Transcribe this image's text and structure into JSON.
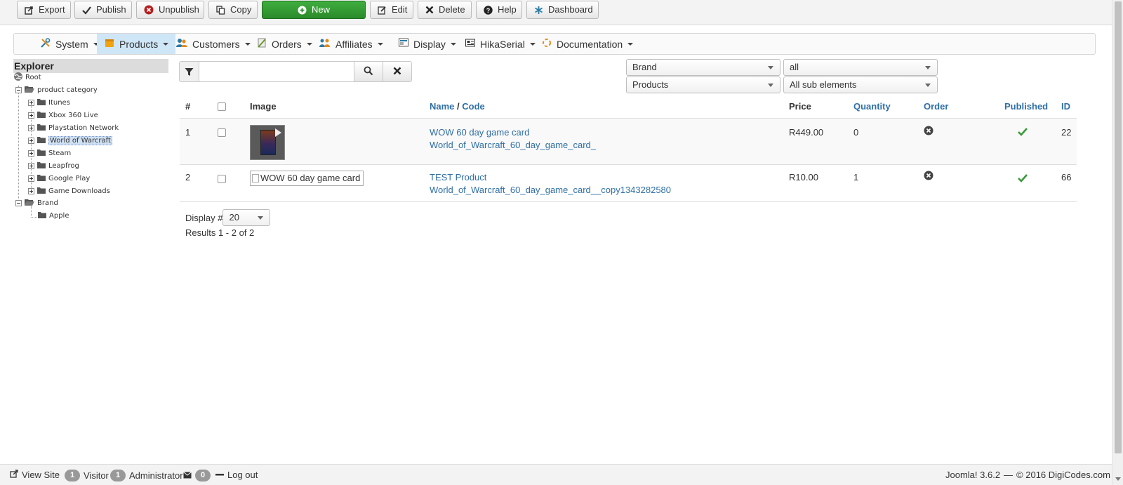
{
  "toolbar": {
    "export": "Export",
    "publish": "Publish",
    "unpublish": "Unpublish",
    "copy": "Copy",
    "new": "New",
    "edit": "Edit",
    "delete": "Delete",
    "help": "Help",
    "dashboard": "Dashboard"
  },
  "menu": {
    "system": "System",
    "products": "Products",
    "customers": "Customers",
    "orders": "Orders",
    "affiliates": "Affiliates",
    "display": "Display",
    "hikaserial": "HikaSerial",
    "documentation": "Documentation"
  },
  "explorer": {
    "title": "Explorer",
    "root": "Root",
    "product_category": "product category",
    "categories": [
      "Itunes",
      "Xbox 360 Live",
      "Playstation Network",
      "World of Warcraft",
      "Steam",
      "Leapfrog",
      "Google Play",
      "Game Downloads"
    ],
    "brand": "Brand",
    "brand_children": [
      "Apple"
    ]
  },
  "search": {
    "value": ""
  },
  "filters": {
    "brand": "Brand",
    "all": "all",
    "products": "Products",
    "sub_elements": "All sub elements"
  },
  "table": {
    "headers": {
      "num": "#",
      "image": "Image",
      "name": "Name",
      "slash": " / ",
      "code": "Code",
      "price": "Price",
      "quantity": "Quantity",
      "order": "Order",
      "published": "Published",
      "id": "ID"
    },
    "rows": [
      {
        "num": "1",
        "name": "WOW 60 day game card",
        "code": "World_of_Warcraft_60_day_game_card_",
        "price": "R449.00",
        "quantity": "0",
        "id": "22",
        "image_alt": ""
      },
      {
        "num": "2",
        "name": "TEST Product",
        "code": "World_of_Warcraft_60_day_game_card__copy1343282580",
        "price": "R10.00",
        "quantity": "1",
        "id": "66",
        "image_alt": "WOW 60 day game card"
      }
    ]
  },
  "pagination": {
    "display_label": "Display #",
    "display_value": "20",
    "results": "Results 1 - 2 of 2"
  },
  "footer": {
    "view_site": "View Site",
    "visitor_count": "1",
    "visitor": "Visitor",
    "admin_count": "1",
    "administrator": "Administrator",
    "messages_count": "0",
    "logout": "Log out",
    "version": "Joomla! 3.6.2",
    "separator": "—",
    "copyright": "© 2016 DigiCodes.com"
  },
  "colors": {
    "link": "#2f6fa6",
    "new_button": "#2a8a2a",
    "active_menu": "#cfe6f6",
    "published_check": "#3a9a3a"
  }
}
